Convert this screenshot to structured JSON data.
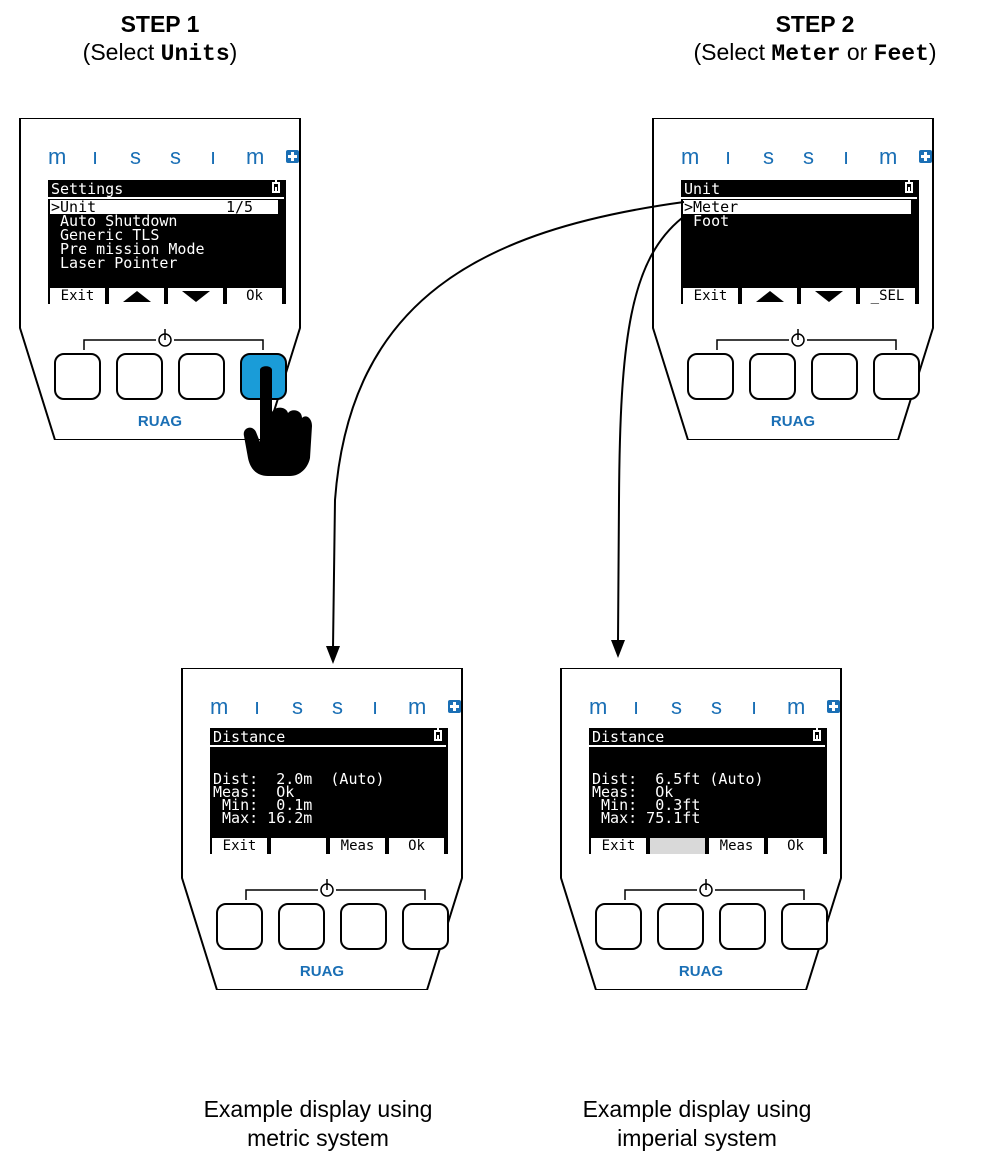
{
  "step1": {
    "title": "STEP 1",
    "pre": "(Select ",
    "code": "Units",
    "post": ")"
  },
  "step2": {
    "title": "STEP 2",
    "pre": "(Select ",
    "code1": "Meter",
    "mid": " or ",
    "code2": "Feet",
    "post": ")"
  },
  "brand": {
    "letters": [
      "m",
      "ı",
      "s",
      "s",
      "ı",
      "m"
    ],
    "logo": "RUAG",
    "accent": "#1a6fb5",
    "button_pressed": "#1a9cd8"
  },
  "device1": {
    "title": "Settings",
    "items": [
      ">Unit",
      " Auto Shutdown",
      " Generic TLS",
      " Pre mission Mode",
      " Laser Pointer"
    ],
    "page": "1/5",
    "keys": [
      "Exit",
      "up-arrow",
      "down-arrow",
      "Ok"
    ]
  },
  "device2": {
    "title": "Unit",
    "items": [
      ">Meter",
      " Foot"
    ],
    "keys": [
      "Exit",
      "up-arrow",
      "down-arrow",
      "_SEL"
    ]
  },
  "device3": {
    "title": "Distance",
    "lines": [
      "Dist:  2.0m  (Auto)",
      "Meas:  Ok",
      " Min:  0.1m",
      " Max: 16.2m"
    ],
    "keys": [
      "Exit",
      "",
      "Meas",
      "Ok"
    ]
  },
  "device4": {
    "title": "Distance",
    "lines": [
      "Dist:  6.5ft (Auto)",
      "Meas:  Ok",
      " Min:  0.3ft",
      " Max: 75.1ft"
    ],
    "keys": [
      "Exit",
      "",
      "Meas",
      "Ok"
    ]
  },
  "captions": {
    "metric": [
      "Example display using",
      "metric system"
    ],
    "imperial": [
      "Example display using",
      "imperial system"
    ]
  }
}
